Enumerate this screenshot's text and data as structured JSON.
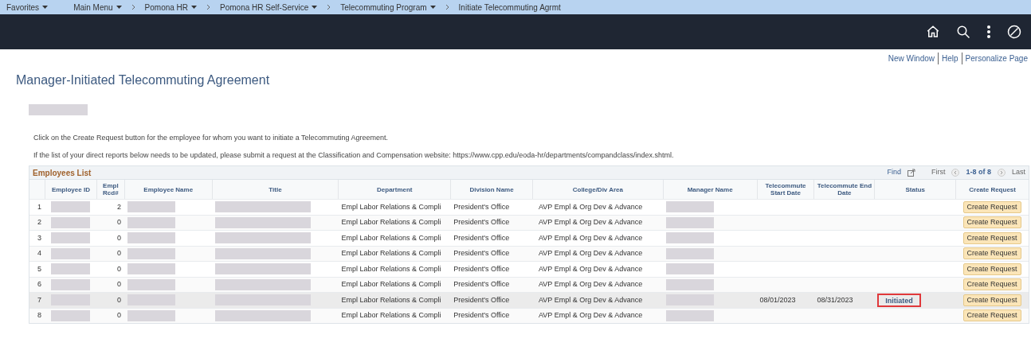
{
  "breadcrumbs": [
    {
      "label": "Favorites",
      "dropdown": true
    },
    {
      "label": "Main Menu",
      "dropdown": true
    },
    {
      "label": "Pomona HR",
      "dropdown": true
    },
    {
      "label": "Pomona HR Self-Service",
      "dropdown": true
    },
    {
      "label": "Telecommuting Program",
      "dropdown": true
    },
    {
      "label": "Initiate Telecommuting Agrmt",
      "dropdown": false
    }
  ],
  "page_links": [
    "New Window",
    "Help",
    "Personalize Page"
  ],
  "title": "Manager-Initiated Telecommuting Agreement",
  "instructions": [
    "Click on the Create Request button for the employee for whom you want to initiate a Telecommuting Agreement.",
    "If the list of your direct reports below needs to be updated, please submit a request at the Classification and Compensation website: https://www.cpp.edu/eoda-hr/departments/compandclass/index.shtml."
  ],
  "grid": {
    "title": "Employees List",
    "find": "Find",
    "first": "First",
    "range": "1-8 of 8",
    "last": "Last",
    "columns": [
      "Employee ID",
      "Empl Rcd#",
      "Employee Name",
      "Title",
      "Department",
      "Division Name",
      "College/Div Area",
      "Manager Name",
      "Telecommute Start Date",
      "Telecommute End Date",
      "Status",
      "Create Request"
    ],
    "rows": [
      {
        "num": "1",
        "rcd": "2",
        "department": "Empl Labor Relations & Compli",
        "division": "President's Office",
        "college": "AVP Empl & Org Dev & Advance",
        "start": "",
        "end": "",
        "status": "",
        "highlighted": false,
        "button": "Create Request",
        "selected": false
      },
      {
        "num": "2",
        "rcd": "0",
        "department": "Empl Labor Relations & Compli",
        "division": "President's Office",
        "college": "AVP Empl & Org Dev & Advance",
        "start": "",
        "end": "",
        "status": "",
        "highlighted": false,
        "button": "Create Request",
        "selected": false
      },
      {
        "num": "3",
        "rcd": "0",
        "department": "Empl Labor Relations & Compli",
        "division": "President's Office",
        "college": "AVP Empl & Org Dev & Advance",
        "start": "",
        "end": "",
        "status": "",
        "highlighted": false,
        "button": "Create Request",
        "selected": false
      },
      {
        "num": "4",
        "rcd": "0",
        "department": "Empl Labor Relations & Compli",
        "division": "President's Office",
        "college": "AVP Empl & Org Dev & Advance",
        "start": "",
        "end": "",
        "status": "",
        "highlighted": false,
        "button": "Create Request",
        "selected": false
      },
      {
        "num": "5",
        "rcd": "0",
        "department": "Empl Labor Relations & Compli",
        "division": "President's Office",
        "college": "AVP Empl & Org Dev & Advance",
        "start": "",
        "end": "",
        "status": "",
        "highlighted": false,
        "button": "Create Request",
        "selected": false
      },
      {
        "num": "6",
        "rcd": "0",
        "department": "Empl Labor Relations & Compli",
        "division": "President's Office",
        "college": "AVP Empl & Org Dev & Advance",
        "start": "",
        "end": "",
        "status": "",
        "highlighted": false,
        "button": "Create Request",
        "selected": false
      },
      {
        "num": "7",
        "rcd": "0",
        "department": "Empl Labor Relations & Compli",
        "division": "President's Office",
        "college": "AVP Empl & Org Dev & Advance",
        "start": "08/01/2023",
        "end": "08/31/2023",
        "status": "Initiated",
        "highlighted": true,
        "button": "Create Request",
        "selected": true
      },
      {
        "num": "8",
        "rcd": "0",
        "department": "Empl Labor Relations & Compli",
        "division": "President's Office",
        "college": "AVP Empl & Org Dev & Advance",
        "start": "",
        "end": "",
        "status": "",
        "highlighted": false,
        "button": "Create Request",
        "selected": false
      }
    ]
  }
}
